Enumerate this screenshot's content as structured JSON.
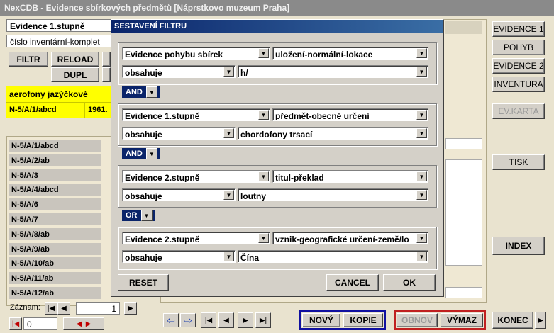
{
  "window_title": "NexCDB - Evidence sbírkových předmětů  [Náprstkovo muzeum Praha]",
  "left": {
    "evidence_field": "Evidence 1.stupně",
    "sort_field": "číslo inventární-komplet",
    "filtr": "FILTR",
    "reload": "RELOAD",
    "dupl": "DUPL",
    "yellow_title": "aerofony jazýčkové",
    "yellow_id": "N-5/A/1/abcd",
    "yellow_year": "1961.",
    "list": [
      "N-5/A/1/abcd",
      "N-5/A/2/ab",
      "N-5/A/3",
      "N-5/A/4/abcd",
      "N-5/A/6",
      "N-5/A/7",
      "N-5/A/8/ab",
      "N-5/A/9/ab",
      "N-5/A/10/ab",
      "N-5/A/11/ab",
      "N-5/A/12/ab"
    ],
    "zaznam_label": "Záznam:",
    "zaznam_value": "1",
    "bottom_value": "0"
  },
  "dialog": {
    "title": "SESTAVENÍ FILTRU",
    "groups": [
      {
        "table": "Evidence pohybu sbírek",
        "field": "uložení-normální-lokace",
        "cond": "obsahuje",
        "value": "h/"
      },
      {
        "table": "Evidence 1.stupně",
        "field": "předmět-obecné určení",
        "cond": "obsahuje",
        "value": "chordofony trsací"
      },
      {
        "table": "Evidence 2.stupně",
        "field": "titul-překlad",
        "cond": "obsahuje",
        "value": "loutny"
      },
      {
        "table": "Evidence 2.stupně",
        "field": "vznik-geografické určení-země/lo",
        "cond": "obsahuje",
        "value": "Čína"
      }
    ],
    "ops": [
      "AND",
      "AND",
      "OR"
    ],
    "reset": "RESET",
    "cancel": "CANCEL",
    "ok": "OK"
  },
  "right": {
    "evidence1": "EVIDENCE 1",
    "pohyb": "POHYB",
    "evidence2": "EVIDENCE 2",
    "inventura": "INVENTURA",
    "evkarta": "EV.KARTA",
    "tisk": "TISK",
    "index": "INDEX",
    "konec": "KONEC"
  },
  "bottom": {
    "novy": "NOVÝ",
    "kopie": "KOPIE",
    "obnov": "OBNOV",
    "vymaz": "VÝMAZ"
  },
  "colors": {
    "dialog_title": "#0a246a",
    "yellow": "#ffff00",
    "blue_frame": "#1010a0",
    "red_frame": "#c02020"
  }
}
